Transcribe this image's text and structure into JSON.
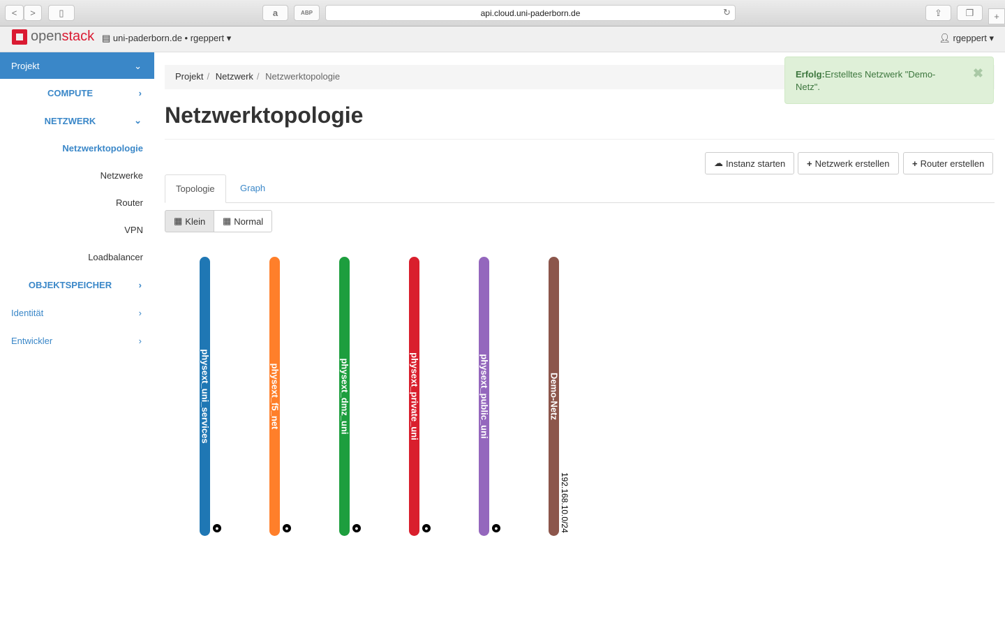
{
  "browser": {
    "url": "api.cloud.uni-paderborn.de",
    "amazon_label": "a",
    "abp_label": "ABP"
  },
  "header": {
    "logo_text_a": "open",
    "logo_text_b": "stack",
    "project": "uni-paderborn.de • rgeppert",
    "user": "rgeppert"
  },
  "sidebar": {
    "head": "Projekt",
    "compute": "COMPUTE",
    "netzwerk": "NETZWERK",
    "items": [
      "Netzwerktopologie",
      "Netzwerke",
      "Router",
      "VPN",
      "Loadbalancer"
    ],
    "objekt": "OBJEKTSPEICHER",
    "identitaet": "Identität",
    "entwickler": "Entwickler"
  },
  "breadcrumb": [
    "Projekt",
    "Netzwerk",
    "Netzwerktopologie"
  ],
  "title": "Netzwerktopologie",
  "alert": {
    "strong": "Erfolg:",
    "text": "Erstelltes Netzwerk \"Demo-Netz\".",
    "close": "✖"
  },
  "actions": {
    "launch": "Instanz starten",
    "create_net": "Netzwerk erstellen",
    "create_router": "Router erstellen"
  },
  "tabs": [
    "Topologie",
    "Graph"
  ],
  "sizes": {
    "small": "Klein",
    "normal": "Normal",
    "selected": "Klein"
  },
  "networks": [
    {
      "name": "physext_uni_services",
      "color": "#1f77b4",
      "external": true
    },
    {
      "name": "physext_f5_net",
      "color": "#ff7f2a",
      "external": true
    },
    {
      "name": "physext_dmz_uni",
      "color": "#1d9e3e",
      "external": true
    },
    {
      "name": "physext_private_uni",
      "color": "#d91f2d",
      "external": true
    },
    {
      "name": "physext_public_uni",
      "color": "#9467bd",
      "external": true
    },
    {
      "name": "Demo-Netz",
      "color": "#8c564b",
      "external": false,
      "cidr": "192.168.10.0/24"
    }
  ]
}
